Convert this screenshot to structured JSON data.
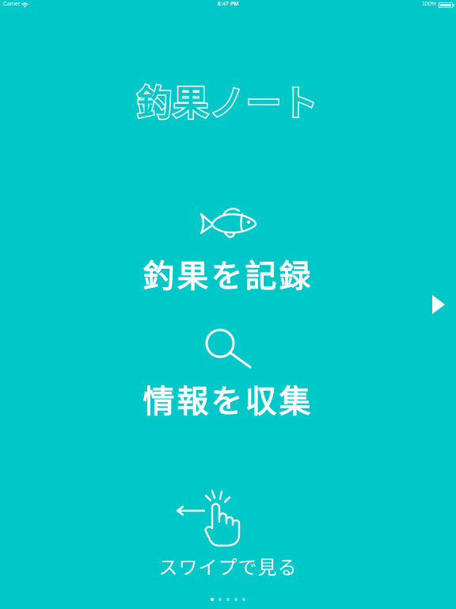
{
  "status_bar": {
    "carrier": "Carrier",
    "time": "6:47 PM",
    "battery": "100%"
  },
  "app": {
    "title": "釣果ノート"
  },
  "features": {
    "record_label": "釣果を記録",
    "info_label": "情報を収集"
  },
  "swipe": {
    "label": "スワイプで見る"
  },
  "pagination": {
    "total": 5,
    "current": 1
  },
  "colors": {
    "background": "#00C8C8",
    "foreground": "#FFFFFF"
  },
  "icons": {
    "wifi": "wifi-icon",
    "battery": "battery-icon",
    "fish": "fish-icon",
    "search": "magnifier-icon",
    "next": "chevron-right-icon",
    "swipe": "swipe-hand-icon"
  }
}
